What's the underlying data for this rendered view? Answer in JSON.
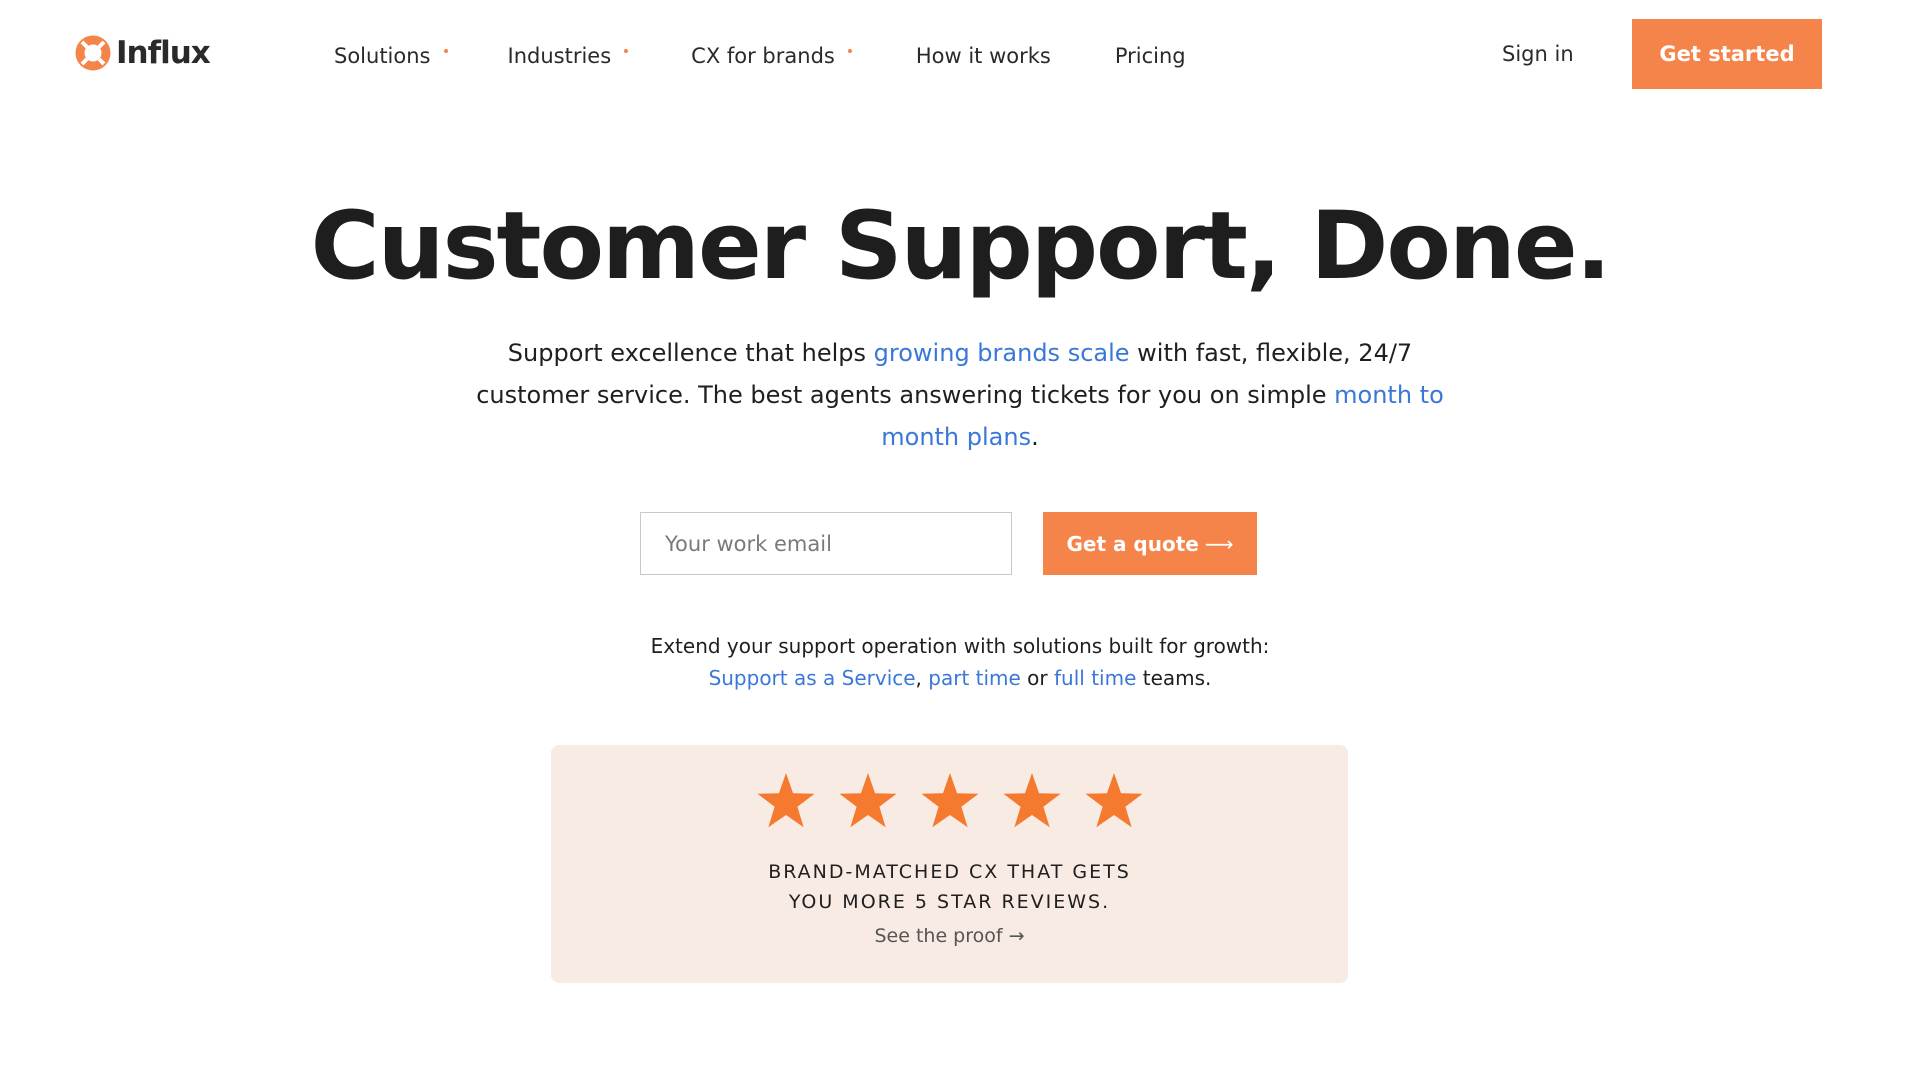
{
  "brand": {
    "name": "Influx",
    "accent_color": "#f5844a",
    "link_color": "#3a78d8"
  },
  "nav": {
    "items": [
      {
        "label": "Solutions",
        "has_dropdown": true
      },
      {
        "label": "Industries",
        "has_dropdown": true
      },
      {
        "label": "CX for brands",
        "has_dropdown": true
      },
      {
        "label": "How it works",
        "has_dropdown": false
      },
      {
        "label": "Pricing",
        "has_dropdown": false
      }
    ],
    "sign_in": "Sign in",
    "get_started": "Get started"
  },
  "hero": {
    "title": "Customer Support, Done.",
    "sub_part1": "Support excellence that helps ",
    "sub_link1": "growing brands scale",
    "sub_part2": " with fast, flexible, 24/7 customer service. The best agents answering tickets for you on simple ",
    "sub_link2": "month to month plans",
    "sub_part3": "."
  },
  "quote_form": {
    "email_placeholder": "Your work email",
    "email_value": "",
    "button_label": "Get a quote",
    "button_arrow": "⟶"
  },
  "extend": {
    "line1": "Extend your support operation with solutions built for growth:",
    "link1": "Support as a Service",
    "sep1": ", ",
    "link2": "part time",
    "sep2": " or ",
    "link3": "full time",
    "suffix": " teams."
  },
  "review": {
    "star_count": 5,
    "star_color": "#f5792f",
    "line1": "BRAND-MATCHED CX THAT GETS",
    "line2": "YOU MORE 5 STAR REVIEWS.",
    "proof_label": "See the proof",
    "proof_arrow": "→"
  }
}
